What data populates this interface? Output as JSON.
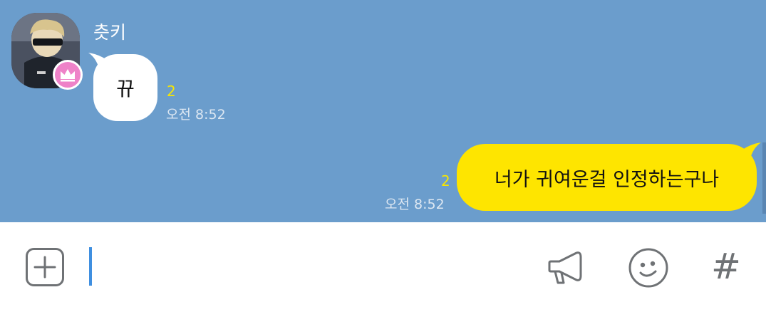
{
  "messages": [
    {
      "direction": "incoming",
      "sender": "츳키",
      "text": "뀨",
      "unread": "2",
      "time": "오전 8:52",
      "avatar_badge_icon": "crown-icon",
      "bubble_color": "#ffffff"
    },
    {
      "direction": "outgoing",
      "text": "너가 귀여운걸 인정하는구나",
      "unread": "2",
      "time": "오전 8:52",
      "bubble_color": "#fee500"
    }
  ],
  "colors": {
    "chat_background": "#6b9dcc",
    "unread_count": "#f7e600",
    "badge": "#ee82c8",
    "cursor": "#3f8fe0"
  },
  "input_bar": {
    "attach_icon": "plus-square-icon",
    "value": "",
    "megaphone_icon": "megaphone-icon",
    "emoji_icon": "emoticon-icon",
    "hash_label": "#"
  }
}
